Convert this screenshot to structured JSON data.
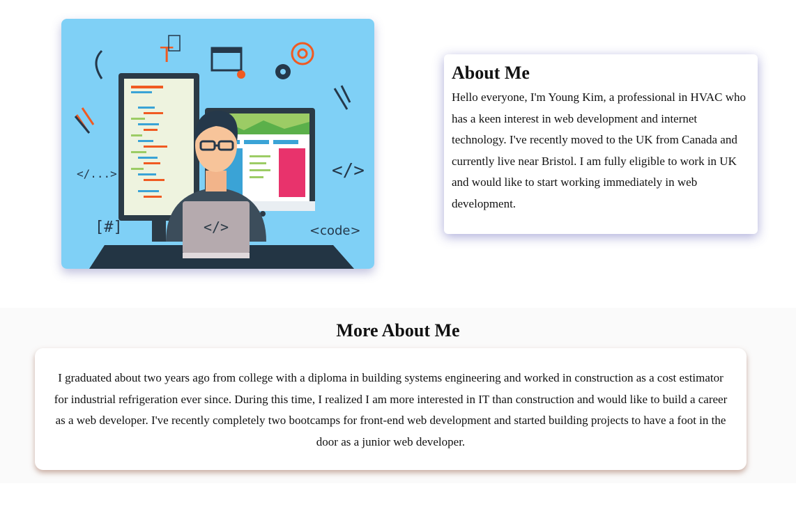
{
  "hero": {
    "image_alt": "Web developer illustration",
    "labels": {
      "code_small": "</...>",
      "code_tag": "</>",
      "hash": "[#]",
      "code_word": "<code>",
      "laptop": "</>",
      "t_letter": "T"
    },
    "colors": {
      "sky": "#7fd0f6",
      "desk": "#233544",
      "monitor": "#2b3a46",
      "accent_orange": "#f05a22",
      "accent_dark": "#25384a"
    }
  },
  "about": {
    "title": "About Me",
    "text": "Hello everyone, I'm Young Kim, a professional in HVAC who has a keen interest in web development and internet technology. I've recently moved to the UK from Canada and currently live near Bristol. I am fully eligible to work in UK and would like to start working immediately in web development."
  },
  "more": {
    "title": "More About Me",
    "text": "I graduated about two years ago from college with a diploma in building systems engineering and worked in construction as a cost estimator for industrial refrigeration ever since. During this time, I realized I am more interested in IT than construction and would like to build a career as a web developer. I've recently completely two bootcamps for front-end web development and started building projects to have a foot in the door as a junior web developer."
  }
}
